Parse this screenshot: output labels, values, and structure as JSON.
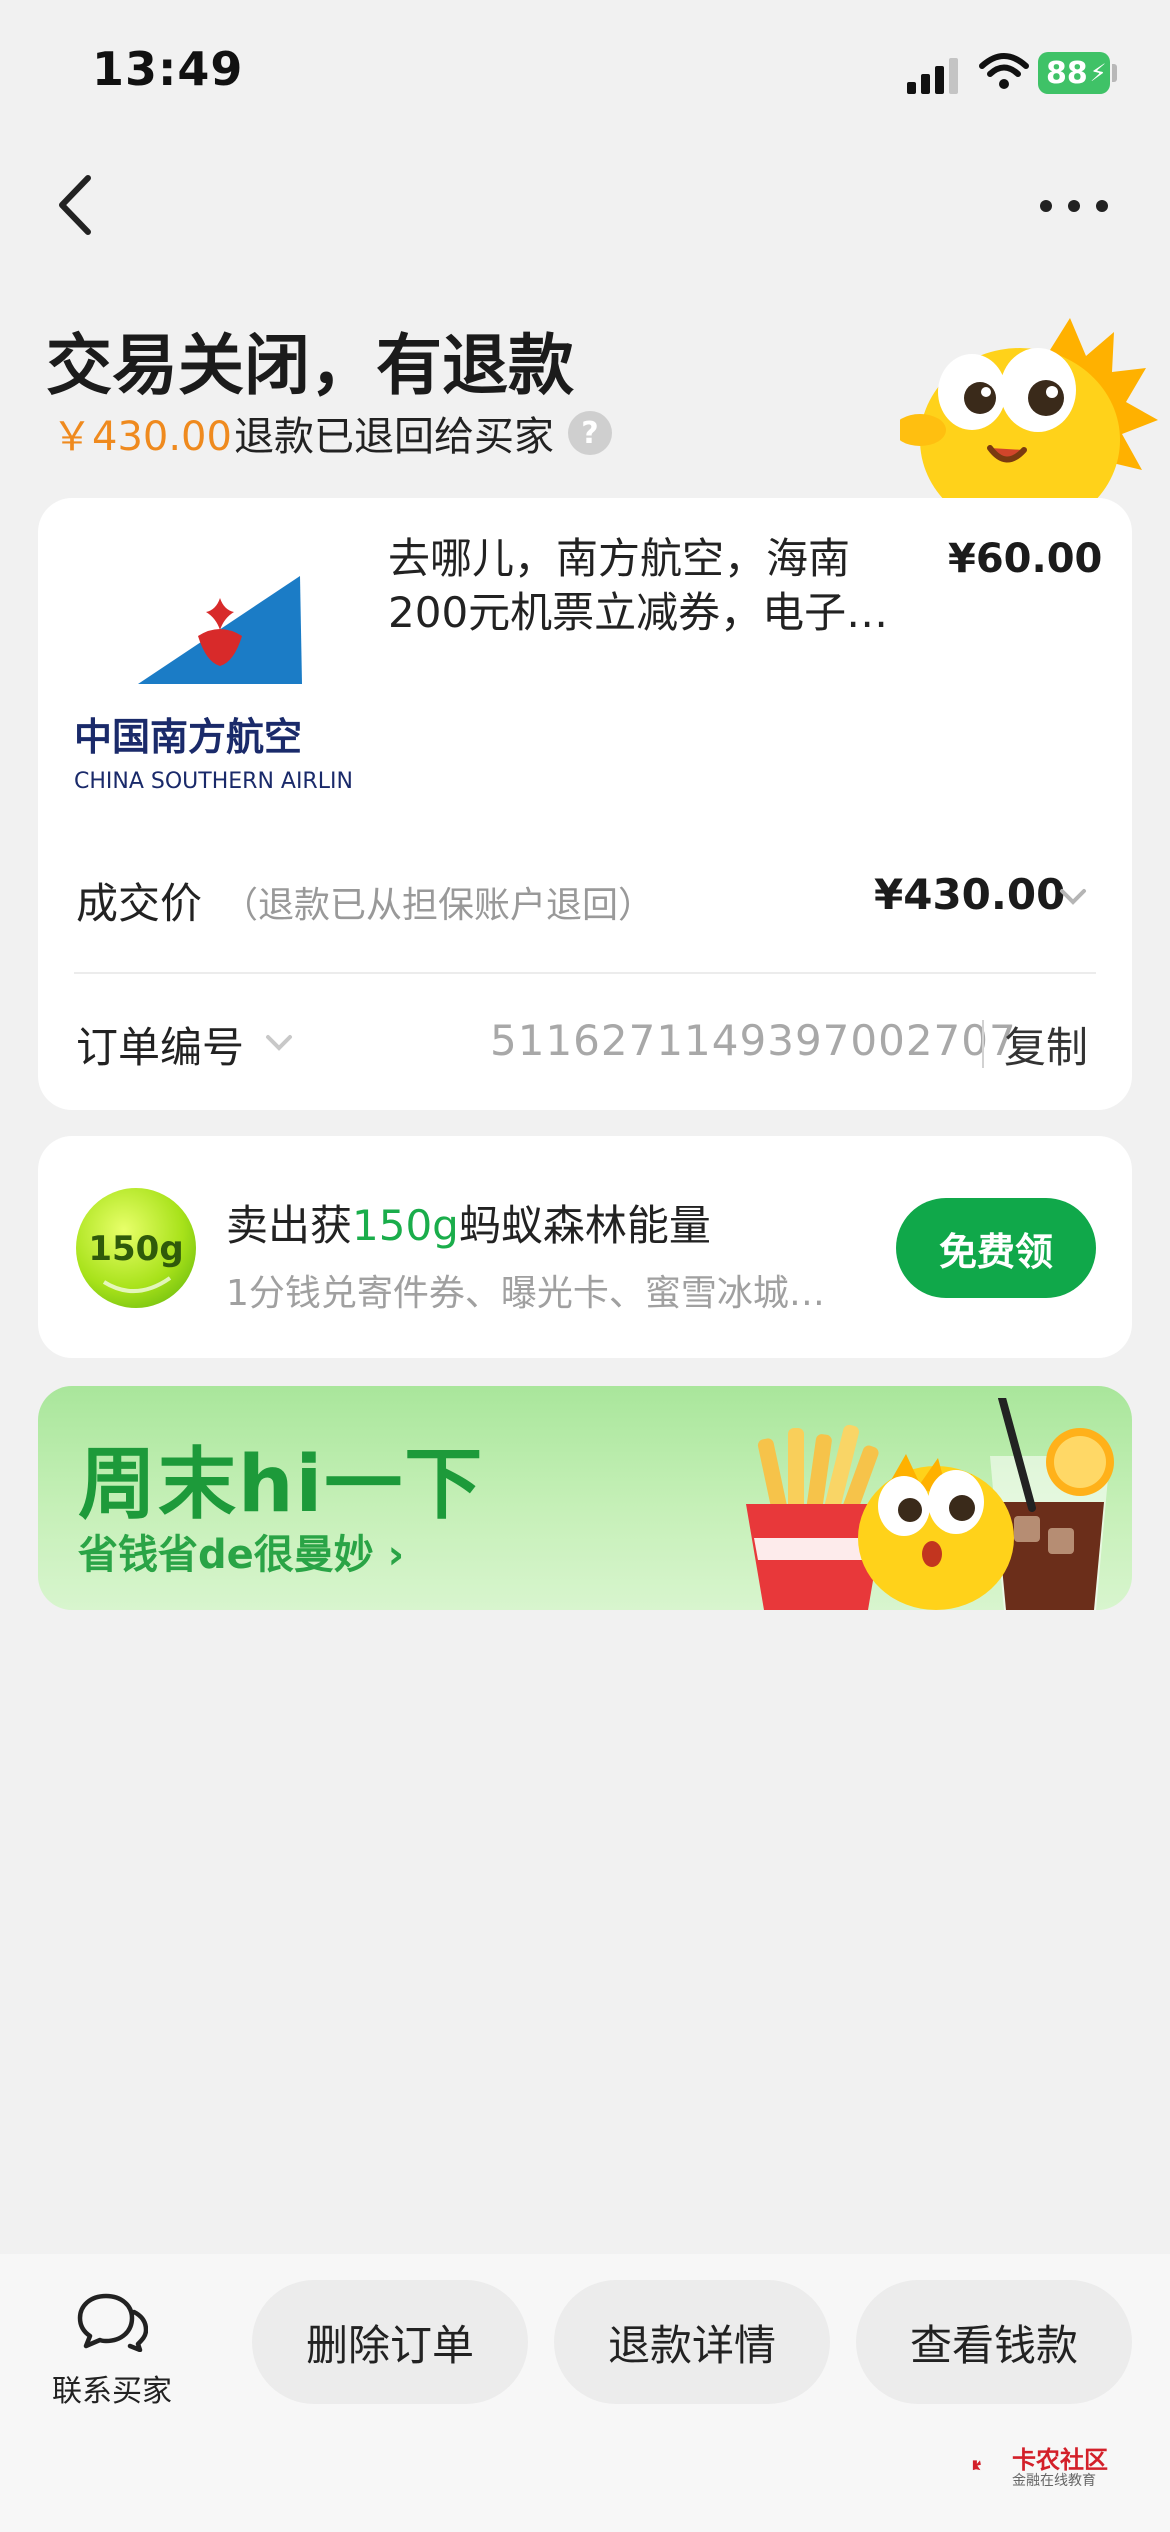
{
  "status": {
    "time": "13:49",
    "battery": "88"
  },
  "header": {
    "title": "交易关闭，有退款",
    "refund_amount": "￥430.00",
    "refund_text": "退款已退回给买家",
    "help": "?"
  },
  "product": {
    "title": "去哪儿，南方航空，海南200元机票立减券，电子…",
    "price": "¥60.00",
    "logo_cn": "中国南方航空",
    "logo_en": "CHINA SOUTHERN AIRLINES"
  },
  "deal": {
    "label": "成交价",
    "note": "（退款已从担保账户退回）",
    "price": "¥430.00"
  },
  "order": {
    "label": "订单编号",
    "number": "5116271149397002707",
    "copy": "复制"
  },
  "energy": {
    "badge": "150g",
    "title_pre": "卖出获",
    "title_highlight": "150g",
    "title_post": "蚂蚁森林能量",
    "subtitle": "1分钱兑寄件券、曝光卡、蜜雪冰城…",
    "button": "免费领"
  },
  "banner": {
    "title": "周末hi一下",
    "subtitle": "省钱省de很曼妙 ›"
  },
  "bottom": {
    "contact": "联系买家",
    "delete": "删除订单",
    "refund_detail": "退款详情",
    "view_money": "查看钱款"
  },
  "watermark": {
    "name": "卡农社区",
    "sub": "金融在线教育"
  },
  "colors": {
    "accent_green": "#10a84a",
    "refund_orange": "#ef8a1e",
    "banner_green": "#1d9a3a"
  }
}
